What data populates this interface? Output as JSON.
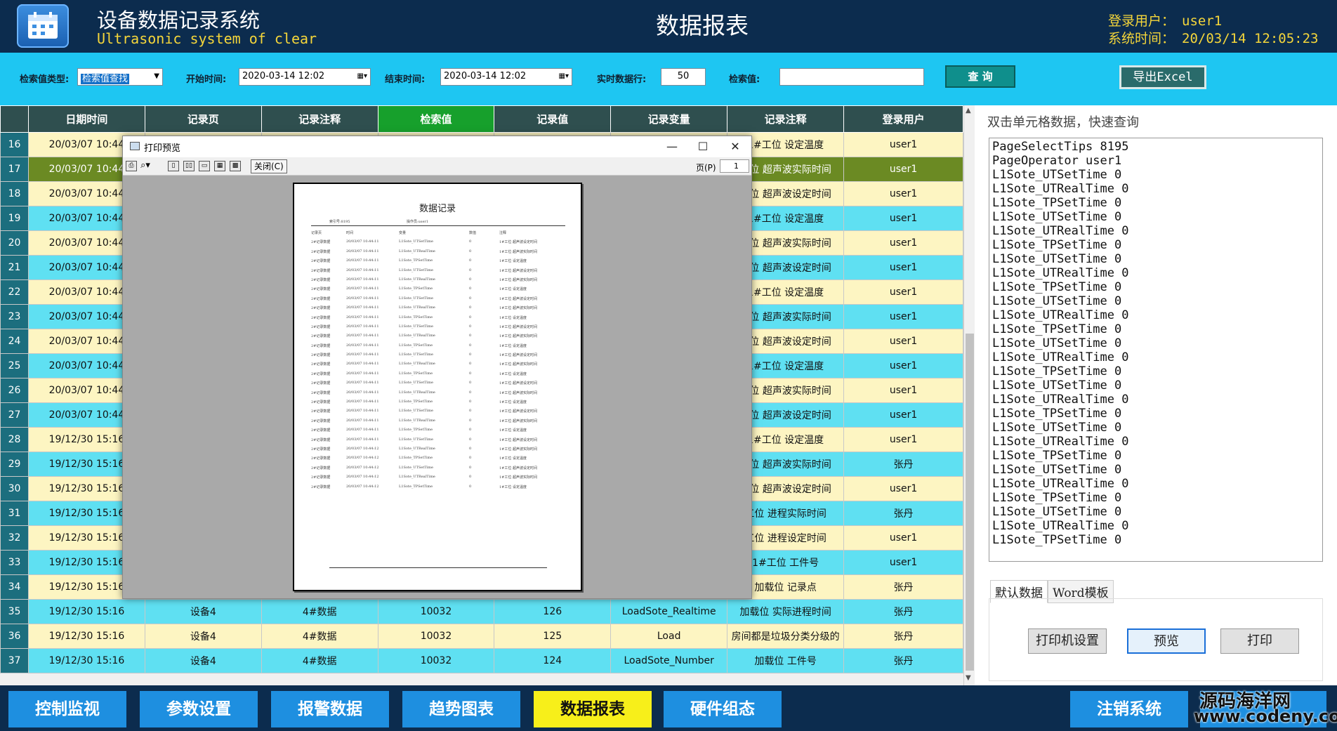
{
  "header": {
    "app_title": "设备数据记录系统",
    "app_subtitle": "Ultrasonic system of clear",
    "page_title": "数据报表",
    "login_label": "登录用户：",
    "login_value": "user1",
    "time_label": "系统时间：",
    "time_value": "20/03/14 12:05:23"
  },
  "toolbar": {
    "type_label": "检索值类型:",
    "type_value": "检索值查找",
    "start_label": "开始时间:",
    "start_value": "2020-03-14 12:02",
    "end_label": "结束时间:",
    "end_value": "2020-03-14 12:02",
    "rows_label": "实时数据行:",
    "rows_value": "50",
    "search_label": "检索值:",
    "search_value": "",
    "query_label": "查 询",
    "export_label": "导出Excel"
  },
  "table": {
    "columns": [
      "日期时间",
      "记录页",
      "记录注释",
      "检索值",
      "记录值",
      "记录变量",
      "记录注释",
      "登录用户"
    ],
    "rows": [
      {
        "n": "16",
        "date": "20/03/07 10:44",
        "page": "",
        "note": "",
        "key": "",
        "val": "",
        "var": "",
        "note2": "1#工位 设定温度",
        "user": "user1",
        "style": "y"
      },
      {
        "n": "17",
        "date": "20/03/07 10:44",
        "page": "",
        "note": "",
        "key": "",
        "val": "",
        "var": "",
        "note2": "工位 超声波实际时间",
        "user": "user1",
        "style": "sel"
      },
      {
        "n": "18",
        "date": "20/03/07 10:44",
        "page": "",
        "note": "",
        "key": "",
        "val": "",
        "var": "",
        "note2": "工位 超声波设定时间",
        "user": "user1",
        "style": "y"
      },
      {
        "n": "19",
        "date": "20/03/07 10:44",
        "page": "",
        "note": "",
        "key": "",
        "val": "",
        "var": "",
        "note2": "1#工位 设定温度",
        "user": "user1",
        "style": "c"
      },
      {
        "n": "20",
        "date": "20/03/07 10:44",
        "page": "",
        "note": "",
        "key": "",
        "val": "",
        "var": "",
        "note2": "工位 超声波实际时间",
        "user": "user1",
        "style": "y"
      },
      {
        "n": "21",
        "date": "20/03/07 10:44",
        "page": "",
        "note": "",
        "key": "",
        "val": "",
        "var": "",
        "note2": "工位 超声波设定时间",
        "user": "user1",
        "style": "c"
      },
      {
        "n": "22",
        "date": "20/03/07 10:44",
        "page": "",
        "note": "",
        "key": "",
        "val": "",
        "var": "",
        "note2": "1#工位 设定温度",
        "user": "user1",
        "style": "y"
      },
      {
        "n": "23",
        "date": "20/03/07 10:44",
        "page": "",
        "note": "",
        "key": "",
        "val": "",
        "var": "",
        "note2": "工位 超声波实际时间",
        "user": "user1",
        "style": "c"
      },
      {
        "n": "24",
        "date": "20/03/07 10:44",
        "page": "",
        "note": "",
        "key": "",
        "val": "",
        "var": "",
        "note2": "工位 超声波设定时间",
        "user": "user1",
        "style": "y"
      },
      {
        "n": "25",
        "date": "20/03/07 10:44",
        "page": "",
        "note": "",
        "key": "",
        "val": "",
        "var": "",
        "note2": "1#工位 设定温度",
        "user": "user1",
        "style": "c"
      },
      {
        "n": "26",
        "date": "20/03/07 10:44",
        "page": "",
        "note": "",
        "key": "",
        "val": "",
        "var": "",
        "note2": "工位 超声波实际时间",
        "user": "user1",
        "style": "y"
      },
      {
        "n": "27",
        "date": "20/03/07 10:44",
        "page": "",
        "note": "",
        "key": "",
        "val": "",
        "var": "",
        "note2": "工位 超声波设定时间",
        "user": "user1",
        "style": "c"
      },
      {
        "n": "28",
        "date": "19/12/30 15:16",
        "page": "",
        "note": "",
        "key": "",
        "val": "",
        "var": "",
        "note2": "1#工位 设定温度",
        "user": "user1",
        "style": "y"
      },
      {
        "n": "29",
        "date": "19/12/30 15:16",
        "page": "",
        "note": "",
        "key": "",
        "val": "",
        "var": "",
        "note2": "工位 超声波实际时间",
        "user": "张丹",
        "style": "c"
      },
      {
        "n": "30",
        "date": "19/12/30 15:16",
        "page": "",
        "note": "",
        "key": "",
        "val": "",
        "var": "",
        "note2": "工位 超声波设定时间",
        "user": "user1",
        "style": "y"
      },
      {
        "n": "31",
        "date": "19/12/30 15:16",
        "page": "",
        "note": "",
        "key": "",
        "val": "",
        "var": "",
        "note2": "工位 进程实际时间",
        "user": "张丹",
        "style": "c"
      },
      {
        "n": "32",
        "date": "19/12/30 15:16",
        "page": "",
        "note": "",
        "key": "",
        "val": "",
        "var": "",
        "note2": "工位 进程设定时间",
        "user": "user1",
        "style": "y"
      },
      {
        "n": "33",
        "date": "19/12/30 15:16",
        "page": "",
        "note": "",
        "key": "",
        "val": "",
        "var": "",
        "note2": "1#工位 工件号",
        "user": "user1",
        "style": "c"
      },
      {
        "n": "34",
        "date": "19/12/30 15:16",
        "page": "",
        "note": "",
        "key": "",
        "val": "",
        "var": "",
        "note2": "加载位 记录点",
        "user": "张丹",
        "style": "y"
      },
      {
        "n": "35",
        "date": "19/12/30 15:16",
        "page": "设备4",
        "note": "4#数据",
        "key": "10032",
        "val": "126",
        "var": "LoadSote_Realtime",
        "note2": "加载位 实际进程时间",
        "user": "张丹",
        "style": "c"
      },
      {
        "n": "36",
        "date": "19/12/30 15:16",
        "page": "设备4",
        "note": "4#数据",
        "key": "10032",
        "val": "125",
        "var": "Load",
        "note2": "房间都是垃圾分类分级的",
        "user": "张丹",
        "style": "y"
      },
      {
        "n": "37",
        "date": "19/12/30 15:16",
        "page": "设备4",
        "note": "4#数据",
        "key": "10032",
        "val": "124",
        "var": "LoadSote_Number",
        "note2": "加载位 工件号",
        "user": "张丹",
        "style": "c"
      }
    ]
  },
  "right_panel": {
    "title": "双击单元格数据，快速查询",
    "list": [
      "PageSelectTips 8195",
      "PageOperator user1",
      "L1Sote_UTSetTime 0",
      "L1Sote_UTRealTime 0",
      "L1Sote_TPSetTime 0",
      "L1Sote_UTSetTime 0",
      "L1Sote_UTRealTime 0",
      "L1Sote_TPSetTime 0",
      "L1Sote_UTSetTime 0",
      "L1Sote_UTRealTime 0",
      "L1Sote_TPSetTime 0",
      "L1Sote_UTSetTime 0",
      "L1Sote_UTRealTime 0",
      "L1Sote_TPSetTime 0",
      "L1Sote_UTSetTime 0",
      "L1Sote_UTRealTime 0",
      "L1Sote_TPSetTime 0",
      "L1Sote_UTSetTime 0",
      "L1Sote_UTRealTime 0",
      "L1Sote_TPSetTime 0",
      "L1Sote_UTSetTime 0",
      "L1Sote_UTRealTime 0",
      "L1Sote_TPSetTime 0",
      "L1Sote_UTSetTime 0",
      "L1Sote_UTRealTime 0",
      "L1Sote_TPSetTime 0",
      "L1Sote_UTSetTime 0",
      "L1Sote_UTRealTime 0",
      "L1Sote_TPSetTime 0"
    ],
    "tab_default": "默认数据",
    "tab_word": "Word模板",
    "btn_printer": "打印机设置",
    "btn_preview": "预览",
    "btn_print": "打印"
  },
  "print_dialog": {
    "title": "打印预览",
    "close_label": "关闭(C)",
    "page_label": "页(P)",
    "page_value": "1",
    "paper_title": "数据记录",
    "paper_meta_left": "索引号:8195",
    "paper_meta_right": "操作员:user1",
    "paper_headers": [
      "记录页",
      "时间",
      "变量",
      "数值",
      "注释"
    ],
    "paper_rows": [
      [
        "2#记录数据",
        "20/03/07 10:44:11",
        "L1Sote_UTSetTime",
        "0",
        "1#工位 超声波设定时间"
      ],
      [
        "2#记录数据",
        "20/03/07 10:44:11",
        "L1Sote_UTRealTime",
        "0",
        "1#工位 超声波实际时间"
      ],
      [
        "2#记录数据",
        "20/03/07 10:44:11",
        "L1Sote_TPSetTime",
        "0",
        "1#工位 设定温度"
      ],
      [
        "2#记录数据",
        "20/03/07 10:44:11",
        "L1Sote_UTSetTime",
        "0",
        "1#工位 超声波设定时间"
      ],
      [
        "2#记录数据",
        "20/03/07 10:44:11",
        "L1Sote_UTRealTime",
        "0",
        "1#工位 超声波实际时间"
      ],
      [
        "2#记录数据",
        "20/03/07 10:44:11",
        "L1Sote_TPSetTime",
        "0",
        "1#工位 设定温度"
      ],
      [
        "2#记录数据",
        "20/03/07 10:44:11",
        "L1Sote_UTSetTime",
        "0",
        "1#工位 超声波设定时间"
      ],
      [
        "2#记录数据",
        "20/03/07 10:44:11",
        "L1Sote_UTRealTime",
        "0",
        "1#工位 超声波实际时间"
      ],
      [
        "2#记录数据",
        "20/03/07 10:44:11",
        "L1Sote_TPSetTime",
        "0",
        "1#工位 设定温度"
      ],
      [
        "2#记录数据",
        "20/03/07 10:44:11",
        "L1Sote_UTSetTime",
        "0",
        "1#工位 超声波设定时间"
      ],
      [
        "2#记录数据",
        "20/03/07 10:44:11",
        "L1Sote_UTRealTime",
        "0",
        "1#工位 超声波实际时间"
      ],
      [
        "2#记录数据",
        "20/03/07 10:44:11",
        "L1Sote_TPSetTime",
        "0",
        "1#工位 设定温度"
      ],
      [
        "2#记录数据",
        "20/03/07 10:44:11",
        "L1Sote_UTSetTime",
        "0",
        "1#工位 超声波设定时间"
      ],
      [
        "2#记录数据",
        "20/03/07 10:44:11",
        "L1Sote_UTRealTime",
        "0",
        "1#工位 超声波实际时间"
      ],
      [
        "2#记录数据",
        "20/03/07 10:44:11",
        "L1Sote_TPSetTime",
        "0",
        "1#工位 设定温度"
      ],
      [
        "2#记录数据",
        "20/03/07 10:44:11",
        "L1Sote_UTSetTime",
        "0",
        "1#工位 超声波设定时间"
      ],
      [
        "2#记录数据",
        "20/03/07 10:44:11",
        "L1Sote_UTRealTime",
        "0",
        "1#工位 超声波实际时间"
      ],
      [
        "2#记录数据",
        "20/03/07 10:44:11",
        "L1Sote_TPSetTime",
        "0",
        "1#工位 设定温度"
      ],
      [
        "2#记录数据",
        "20/03/07 10:44:11",
        "L1Sote_UTSetTime",
        "0",
        "1#工位 超声波设定时间"
      ],
      [
        "2#记录数据",
        "20/03/07 10:44:11",
        "L1Sote_UTRealTime",
        "0",
        "1#工位 超声波实际时间"
      ],
      [
        "2#记录数据",
        "20/03/07 10:44:11",
        "L1Sote_TPSetTime",
        "0",
        "1#工位 设定温度"
      ],
      [
        "2#记录数据",
        "20/03/07 10:44:11",
        "L1Sote_UTSetTime",
        "0",
        "1#工位 超声波设定时间"
      ],
      [
        "2#记录数据",
        "20/03/07 10:44:12",
        "L1Sote_UTRealTime",
        "0",
        "1#工位 超声波实际时间"
      ],
      [
        "2#记录数据",
        "20/03/07 10:44:12",
        "L1Sote_TPSetTime",
        "0",
        "1#工位 设定温度"
      ],
      [
        "2#记录数据",
        "20/03/07 10:44:12",
        "L1Sote_UTSetTime",
        "0",
        "1#工位 超声波设定时间"
      ],
      [
        "2#记录数据",
        "20/03/07 10:44:12",
        "L1Sote_UTRealTime",
        "0",
        "1#工位 超声波实际时间"
      ],
      [
        "2#记录数据",
        "20/03/07 10:44:12",
        "L1Sote_TPSetTime",
        "0",
        "1#工位 设定温度"
      ]
    ]
  },
  "nav": {
    "items": [
      "控制监视",
      "参数设置",
      "报警数据",
      "趋势图表",
      "数据报表",
      "硬件组态"
    ],
    "logout": "注销系统",
    "watermark_top": "源码海洋网",
    "watermark_bottom": "www.codeny.com"
  }
}
